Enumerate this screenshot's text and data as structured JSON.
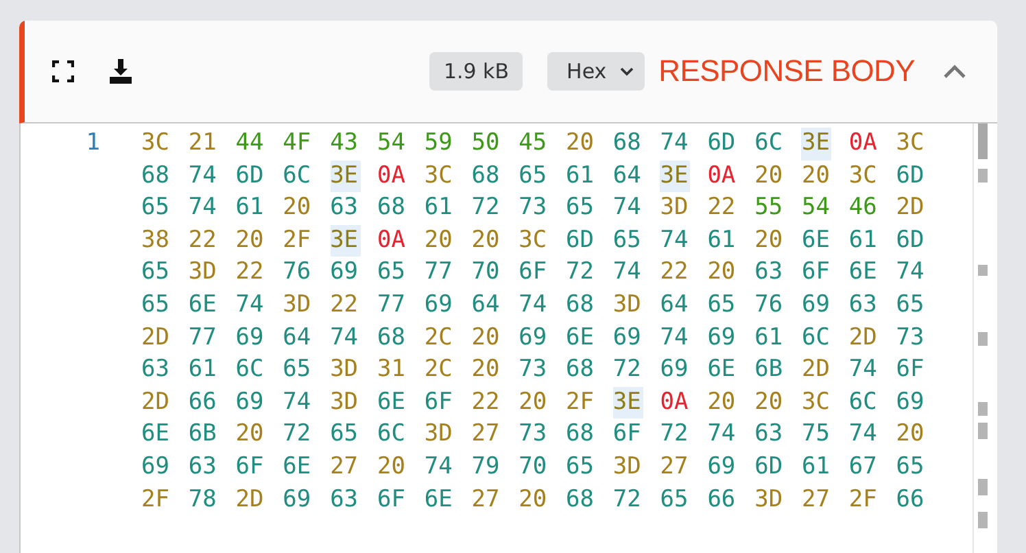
{
  "header": {
    "size_badge": "1.9 kB",
    "format_select": {
      "value": "Hex"
    },
    "title": "RESPONSE BODY",
    "collapsed": false
  },
  "hex_view": {
    "line_number": "1",
    "rows": [
      [
        {
          "b": "3C",
          "highlighted": false
        },
        {
          "b": "21",
          "highlighted": false
        },
        {
          "b": "44",
          "highlighted": false
        },
        {
          "b": "4F",
          "highlighted": false
        },
        {
          "b": "43",
          "highlighted": false
        },
        {
          "b": "54",
          "highlighted": false
        },
        {
          "b": "59",
          "highlighted": false
        },
        {
          "b": "50",
          "highlighted": false
        },
        {
          "b": "45",
          "highlighted": false
        },
        {
          "b": "20",
          "highlighted": false
        },
        {
          "b": "68",
          "highlighted": false
        },
        {
          "b": "74",
          "highlighted": false
        },
        {
          "b": "6D",
          "highlighted": false
        },
        {
          "b": "6C",
          "highlighted": false
        },
        {
          "b": "3E",
          "highlighted": true
        },
        {
          "b": "0A",
          "highlighted": false
        },
        {
          "b": "3C",
          "highlighted": false
        }
      ],
      [
        {
          "b": "68",
          "highlighted": false
        },
        {
          "b": "74",
          "highlighted": false
        },
        {
          "b": "6D",
          "highlighted": false
        },
        {
          "b": "6C",
          "highlighted": false
        },
        {
          "b": "3E",
          "highlighted": true
        },
        {
          "b": "0A",
          "highlighted": false
        },
        {
          "b": "3C",
          "highlighted": false
        },
        {
          "b": "68",
          "highlighted": false
        },
        {
          "b": "65",
          "highlighted": false
        },
        {
          "b": "61",
          "highlighted": false
        },
        {
          "b": "64",
          "highlighted": false
        },
        {
          "b": "3E",
          "highlighted": true
        },
        {
          "b": "0A",
          "highlighted": false
        },
        {
          "b": "20",
          "highlighted": false
        },
        {
          "b": "20",
          "highlighted": false
        },
        {
          "b": "3C",
          "highlighted": false
        },
        {
          "b": "6D",
          "highlighted": false
        }
      ],
      [
        {
          "b": "65",
          "highlighted": false
        },
        {
          "b": "74",
          "highlighted": false
        },
        {
          "b": "61",
          "highlighted": false
        },
        {
          "b": "20",
          "highlighted": false
        },
        {
          "b": "63",
          "highlighted": false
        },
        {
          "b": "68",
          "highlighted": false
        },
        {
          "b": "61",
          "highlighted": false
        },
        {
          "b": "72",
          "highlighted": false
        },
        {
          "b": "73",
          "highlighted": false
        },
        {
          "b": "65",
          "highlighted": false
        },
        {
          "b": "74",
          "highlighted": false
        },
        {
          "b": "3D",
          "highlighted": false
        },
        {
          "b": "22",
          "highlighted": false
        },
        {
          "b": "55",
          "highlighted": false
        },
        {
          "b": "54",
          "highlighted": false
        },
        {
          "b": "46",
          "highlighted": false
        },
        {
          "b": "2D",
          "highlighted": false
        }
      ],
      [
        {
          "b": "38",
          "highlighted": false
        },
        {
          "b": "22",
          "highlighted": false
        },
        {
          "b": "20",
          "highlighted": false
        },
        {
          "b": "2F",
          "highlighted": false
        },
        {
          "b": "3E",
          "highlighted": true
        },
        {
          "b": "0A",
          "highlighted": false
        },
        {
          "b": "20",
          "highlighted": false
        },
        {
          "b": "20",
          "highlighted": false
        },
        {
          "b": "3C",
          "highlighted": false
        },
        {
          "b": "6D",
          "highlighted": false
        },
        {
          "b": "65",
          "highlighted": false
        },
        {
          "b": "74",
          "highlighted": false
        },
        {
          "b": "61",
          "highlighted": false
        },
        {
          "b": "20",
          "highlighted": false
        },
        {
          "b": "6E",
          "highlighted": false
        },
        {
          "b": "61",
          "highlighted": false
        },
        {
          "b": "6D",
          "highlighted": false
        }
      ],
      [
        {
          "b": "65",
          "highlighted": false
        },
        {
          "b": "3D",
          "highlighted": false
        },
        {
          "b": "22",
          "highlighted": false
        },
        {
          "b": "76",
          "highlighted": false
        },
        {
          "b": "69",
          "highlighted": false
        },
        {
          "b": "65",
          "highlighted": false
        },
        {
          "b": "77",
          "highlighted": false
        },
        {
          "b": "70",
          "highlighted": false
        },
        {
          "b": "6F",
          "highlighted": false
        },
        {
          "b": "72",
          "highlighted": false
        },
        {
          "b": "74",
          "highlighted": false
        },
        {
          "b": "22",
          "highlighted": false
        },
        {
          "b": "20",
          "highlighted": false
        },
        {
          "b": "63",
          "highlighted": false
        },
        {
          "b": "6F",
          "highlighted": false
        },
        {
          "b": "6E",
          "highlighted": false
        },
        {
          "b": "74",
          "highlighted": false
        }
      ],
      [
        {
          "b": "65",
          "highlighted": false
        },
        {
          "b": "6E",
          "highlighted": false
        },
        {
          "b": "74",
          "highlighted": false
        },
        {
          "b": "3D",
          "highlighted": false
        },
        {
          "b": "22",
          "highlighted": false
        },
        {
          "b": "77",
          "highlighted": false
        },
        {
          "b": "69",
          "highlighted": false
        },
        {
          "b": "64",
          "highlighted": false
        },
        {
          "b": "74",
          "highlighted": false
        },
        {
          "b": "68",
          "highlighted": false
        },
        {
          "b": "3D",
          "highlighted": false
        },
        {
          "b": "64",
          "highlighted": false
        },
        {
          "b": "65",
          "highlighted": false
        },
        {
          "b": "76",
          "highlighted": false
        },
        {
          "b": "69",
          "highlighted": false
        },
        {
          "b": "63",
          "highlighted": false
        },
        {
          "b": "65",
          "highlighted": false
        }
      ],
      [
        {
          "b": "2D",
          "highlighted": false
        },
        {
          "b": "77",
          "highlighted": false
        },
        {
          "b": "69",
          "highlighted": false
        },
        {
          "b": "64",
          "highlighted": false
        },
        {
          "b": "74",
          "highlighted": false
        },
        {
          "b": "68",
          "highlighted": false
        },
        {
          "b": "2C",
          "highlighted": false
        },
        {
          "b": "20",
          "highlighted": false
        },
        {
          "b": "69",
          "highlighted": false
        },
        {
          "b": "6E",
          "highlighted": false
        },
        {
          "b": "69",
          "highlighted": false
        },
        {
          "b": "74",
          "highlighted": false
        },
        {
          "b": "69",
          "highlighted": false
        },
        {
          "b": "61",
          "highlighted": false
        },
        {
          "b": "6C",
          "highlighted": false
        },
        {
          "b": "2D",
          "highlighted": false
        },
        {
          "b": "73",
          "highlighted": false
        }
      ],
      [
        {
          "b": "63",
          "highlighted": false
        },
        {
          "b": "61",
          "highlighted": false
        },
        {
          "b": "6C",
          "highlighted": false
        },
        {
          "b": "65",
          "highlighted": false
        },
        {
          "b": "3D",
          "highlighted": false
        },
        {
          "b": "31",
          "highlighted": false
        },
        {
          "b": "2C",
          "highlighted": false
        },
        {
          "b": "20",
          "highlighted": false
        },
        {
          "b": "73",
          "highlighted": false
        },
        {
          "b": "68",
          "highlighted": false
        },
        {
          "b": "72",
          "highlighted": false
        },
        {
          "b": "69",
          "highlighted": false
        },
        {
          "b": "6E",
          "highlighted": false
        },
        {
          "b": "6B",
          "highlighted": false
        },
        {
          "b": "2D",
          "highlighted": false
        },
        {
          "b": "74",
          "highlighted": false
        },
        {
          "b": "6F",
          "highlighted": false
        }
      ],
      [
        {
          "b": "2D",
          "highlighted": false
        },
        {
          "b": "66",
          "highlighted": false
        },
        {
          "b": "69",
          "highlighted": false
        },
        {
          "b": "74",
          "highlighted": false
        },
        {
          "b": "3D",
          "highlighted": false
        },
        {
          "b": "6E",
          "highlighted": false
        },
        {
          "b": "6F",
          "highlighted": false
        },
        {
          "b": "22",
          "highlighted": false
        },
        {
          "b": "20",
          "highlighted": false
        },
        {
          "b": "2F",
          "highlighted": false
        },
        {
          "b": "3E",
          "highlighted": true
        },
        {
          "b": "0A",
          "highlighted": false
        },
        {
          "b": "20",
          "highlighted": false
        },
        {
          "b": "20",
          "highlighted": false
        },
        {
          "b": "3C",
          "highlighted": false
        },
        {
          "b": "6C",
          "highlighted": false
        },
        {
          "b": "69",
          "highlighted": false
        }
      ],
      [
        {
          "b": "6E",
          "highlighted": false
        },
        {
          "b": "6B",
          "highlighted": false
        },
        {
          "b": "20",
          "highlighted": false
        },
        {
          "b": "72",
          "highlighted": false
        },
        {
          "b": "65",
          "highlighted": false
        },
        {
          "b": "6C",
          "highlighted": false
        },
        {
          "b": "3D",
          "highlighted": false
        },
        {
          "b": "27",
          "highlighted": false
        },
        {
          "b": "73",
          "highlighted": false
        },
        {
          "b": "68",
          "highlighted": false
        },
        {
          "b": "6F",
          "highlighted": false
        },
        {
          "b": "72",
          "highlighted": false
        },
        {
          "b": "74",
          "highlighted": false
        },
        {
          "b": "63",
          "highlighted": false
        },
        {
          "b": "75",
          "highlighted": false
        },
        {
          "b": "74",
          "highlighted": false
        },
        {
          "b": "20",
          "highlighted": false
        }
      ],
      [
        {
          "b": "69",
          "highlighted": false
        },
        {
          "b": "63",
          "highlighted": false
        },
        {
          "b": "6F",
          "highlighted": false
        },
        {
          "b": "6E",
          "highlighted": false
        },
        {
          "b": "27",
          "highlighted": false
        },
        {
          "b": "20",
          "highlighted": false
        },
        {
          "b": "74",
          "highlighted": false
        },
        {
          "b": "79",
          "highlighted": false
        },
        {
          "b": "70",
          "highlighted": false
        },
        {
          "b": "65",
          "highlighted": false
        },
        {
          "b": "3D",
          "highlighted": false
        },
        {
          "b": "27",
          "highlighted": false
        },
        {
          "b": "69",
          "highlighted": false
        },
        {
          "b": "6D",
          "highlighted": false
        },
        {
          "b": "61",
          "highlighted": false
        },
        {
          "b": "67",
          "highlighted": false
        },
        {
          "b": "65",
          "highlighted": false
        }
      ],
      [
        {
          "b": "2F",
          "highlighted": false
        },
        {
          "b": "78",
          "highlighted": false
        },
        {
          "b": "2D",
          "highlighted": false
        },
        {
          "b": "69",
          "highlighted": false
        },
        {
          "b": "63",
          "highlighted": false
        },
        {
          "b": "6F",
          "highlighted": false
        },
        {
          "b": "6E",
          "highlighted": false
        },
        {
          "b": "27",
          "highlighted": false
        },
        {
          "b": "20",
          "highlighted": false
        },
        {
          "b": "68",
          "highlighted": false
        },
        {
          "b": "72",
          "highlighted": false
        },
        {
          "b": "65",
          "highlighted": false
        },
        {
          "b": "66",
          "highlighted": false
        },
        {
          "b": "3D",
          "highlighted": false
        },
        {
          "b": "27",
          "highlighted": false
        },
        {
          "b": "2F",
          "highlighted": false
        },
        {
          "b": "66",
          "highlighted": false
        }
      ]
    ]
  }
}
